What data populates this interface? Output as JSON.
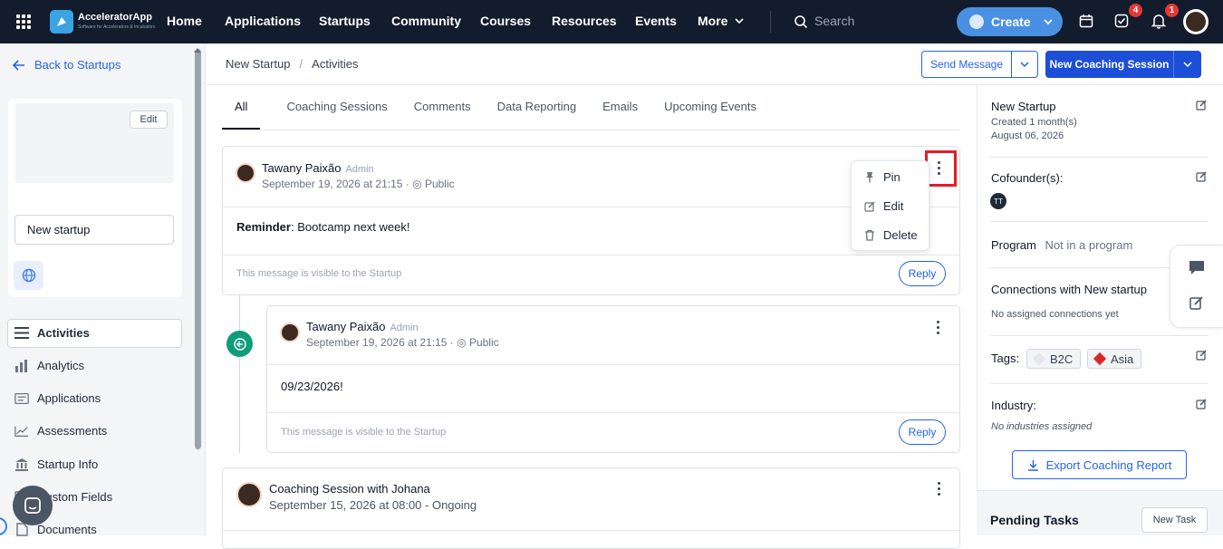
{
  "topbar": {
    "app_name": "AcceleratorApp",
    "app_tagline": "Software for Accelerators & Incubators",
    "nav": [
      "Home",
      "Applications",
      "Startups",
      "Community",
      "Courses",
      "Resources",
      "Events",
      "More"
    ],
    "search_placeholder": "Search",
    "create_label": "Create",
    "tasks_badge": "4",
    "notifications_badge": "1",
    "brand_color": "#4a90e2"
  },
  "sidebar": {
    "back_label": "Back to Startups",
    "edit_label": "Edit",
    "startup_name_value": "New startup",
    "items": [
      {
        "label": "Activities",
        "icon": "list-icon"
      },
      {
        "label": "Analytics",
        "icon": "bar-chart-icon"
      },
      {
        "label": "Applications",
        "icon": "form-icon"
      },
      {
        "label": "Assessments",
        "icon": "line-chart-icon"
      },
      {
        "label": "Startup Info",
        "icon": "bank-icon"
      },
      {
        "label": "Custom Fields",
        "icon": "fields-icon"
      },
      {
        "label": "Documents",
        "icon": "document-icon"
      }
    ]
  },
  "header": {
    "breadcrumb_root": "New Startup",
    "breadcrumb_sep": "/",
    "breadcrumb_current": "Activities",
    "send_message_label": "Send Message",
    "new_session_label": "New Coaching Session"
  },
  "tabs": [
    "All",
    "Coaching Sessions",
    "Comments",
    "Data Reporting",
    "Emails",
    "Upcoming Events"
  ],
  "posts": [
    {
      "author": "Tawany Paixão",
      "role": "Admin",
      "date": "September 19, 2026 at 21:15",
      "visibility": "Public",
      "body_bold": "Reminder",
      "body_rest": ": Bootcamp next week!",
      "note": "This message is visible to the Startup",
      "reply_label": "Reply"
    },
    {
      "author": "Tawany Paixão",
      "role": "Admin",
      "date": "September 19, 2026 at 21:15",
      "visibility": "Public",
      "body": "09/23/2026!",
      "note": "This message is visible to the Startup",
      "reply_label": "Reply"
    },
    {
      "title": "Coaching Session with Johana",
      "subtitle": "September 15, 2026 at 08:00 - Ongoing"
    }
  ],
  "context_menu": {
    "items": [
      {
        "label": "Pin",
        "icon": "pin-icon"
      },
      {
        "label": "Edit",
        "icon": "edit-icon"
      },
      {
        "label": "Delete",
        "icon": "trash-icon"
      }
    ]
  },
  "right_panel": {
    "startup_title": "New Startup",
    "created": "Created 1 month(s)",
    "created_date": "August 06, 2026",
    "cofounders_label": "Cofounder(s):",
    "cofounder_initials": "TT",
    "program_label": "Program",
    "program_value": "Not in a program",
    "connections_label": "Connections with New startup",
    "connections_value": "No assigned connections yet",
    "tags_label": "Tags:",
    "tags": [
      {
        "label": "B2C",
        "color": "#e5e7eb"
      },
      {
        "label": "Asia",
        "color": "#dc2626"
      }
    ],
    "industry_label": "Industry:",
    "industry_value": "No industries assigned",
    "export_label": "Export Coaching Report",
    "pending_label": "Pending Tasks",
    "new_task_label": "New Task"
  }
}
